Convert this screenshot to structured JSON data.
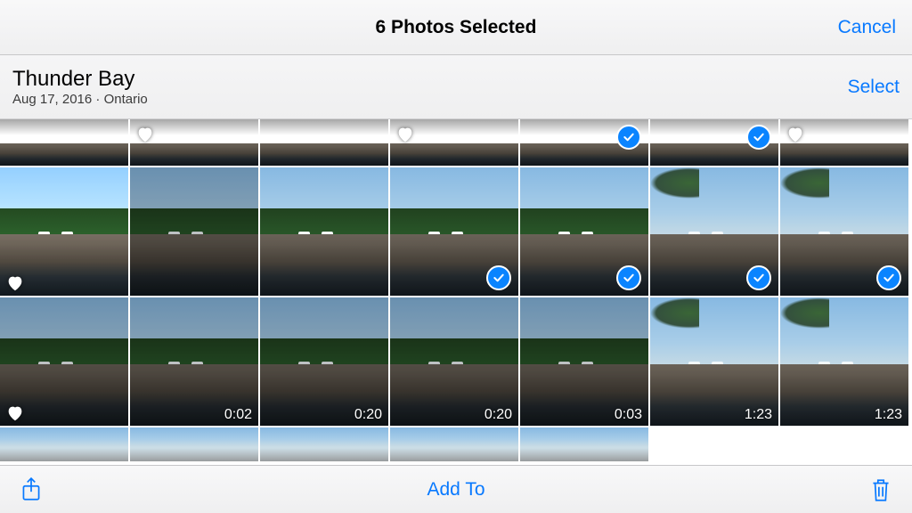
{
  "nav": {
    "title": "6 Photos Selected",
    "cancel": "Cancel"
  },
  "collection": {
    "title": "Thunder Bay",
    "subtitle": "Aug 17, 2016 · Ontario",
    "select": "Select"
  },
  "toolbar": {
    "add_to": "Add To"
  },
  "colors": {
    "accent": "#0879ff"
  },
  "rows": [
    {
      "height": 54,
      "cells": [
        {
          "w": 146,
          "kind": "photo-partial",
          "favorite": false,
          "selected": false
        },
        {
          "w": 146,
          "kind": "photo-partial",
          "favorite": true,
          "selected": false
        },
        {
          "w": 146,
          "kind": "photo-partial",
          "favorite": false,
          "selected": false
        },
        {
          "w": 146,
          "kind": "photo-partial",
          "favorite": true,
          "selected": false
        },
        {
          "w": 146,
          "kind": "photo-partial",
          "favorite": false,
          "selected": true
        },
        {
          "w": 146,
          "kind": "photo-partial",
          "favorite": false,
          "selected": true
        },
        {
          "w": 146,
          "kind": "photo-partial",
          "favorite": true,
          "selected": false
        }
      ]
    },
    {
      "height": 146,
      "cells": [
        {
          "w": 146,
          "kind": "photo",
          "favorite": true,
          "selected": false,
          "variant": "bright"
        },
        {
          "w": 146,
          "kind": "photo",
          "favorite": false,
          "selected": false,
          "variant": "dark"
        },
        {
          "w": 146,
          "kind": "photo",
          "favorite": false,
          "selected": false,
          "variant": "normal"
        },
        {
          "w": 146,
          "kind": "photo",
          "favorite": false,
          "selected": true,
          "variant": "normal"
        },
        {
          "w": 146,
          "kind": "photo",
          "favorite": false,
          "selected": true,
          "variant": "normal"
        },
        {
          "w": 146,
          "kind": "photo",
          "favorite": false,
          "selected": true,
          "variant": "bush"
        },
        {
          "w": 146,
          "kind": "photo",
          "favorite": false,
          "selected": true,
          "variant": "bush"
        }
      ]
    },
    {
      "height": 146,
      "cells": [
        {
          "w": 146,
          "kind": "photo",
          "favorite": true,
          "selected": false,
          "variant": "dark"
        },
        {
          "w": 146,
          "kind": "video",
          "duration": "0:02",
          "variant": "dark"
        },
        {
          "w": 146,
          "kind": "video",
          "duration": "0:20",
          "variant": "dark"
        },
        {
          "w": 146,
          "kind": "video",
          "duration": "0:20",
          "variant": "dark"
        },
        {
          "w": 146,
          "kind": "video",
          "duration": "0:03",
          "variant": "dark"
        },
        {
          "w": 146,
          "kind": "video",
          "duration": "1:23",
          "variant": "bush"
        },
        {
          "w": 146,
          "kind": "video",
          "duration": "1:23",
          "variant": "bush"
        }
      ]
    },
    {
      "height": 40,
      "cells": [
        {
          "w": 146,
          "kind": "photo-partial-bottom"
        },
        {
          "w": 146,
          "kind": "photo-partial-bottom"
        },
        {
          "w": 146,
          "kind": "photo-partial-bottom"
        },
        {
          "w": 146,
          "kind": "photo-partial-bottom"
        },
        {
          "w": 146,
          "kind": "photo-partial-bottom"
        },
        {
          "w": 146,
          "kind": "empty"
        },
        {
          "w": 146,
          "kind": "empty"
        }
      ]
    }
  ]
}
